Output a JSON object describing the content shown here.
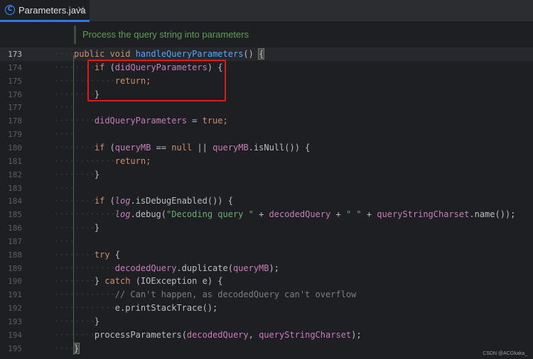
{
  "tab": {
    "icon": "class-c-icon",
    "label": "Parameters.java",
    "close": "×"
  },
  "doc_comment": "Process the query string into parameters",
  "lines": [
    {
      "num": "173",
      "tokens": [
        [
          "kw",
          "public "
        ],
        [
          "kw",
          "void "
        ],
        [
          "fn",
          "handleQueryParameters"
        ],
        [
          "p",
          "() "
        ],
        [
          "brace",
          "{"
        ]
      ]
    },
    {
      "num": "174",
      "tokens": [
        [
          "kw",
          "if "
        ],
        [
          "p",
          "("
        ],
        [
          "fld",
          "didQueryParameters"
        ],
        [
          "p",
          ") {"
        ]
      ]
    },
    {
      "num": "175",
      "tokens": [
        [
          "kw",
          "return"
        ],
        [
          "kw",
          ";"
        ]
      ]
    },
    {
      "num": "176",
      "tokens": [
        [
          "p",
          "}"
        ]
      ]
    },
    {
      "num": "177",
      "tokens": []
    },
    {
      "num": "178",
      "tokens": [
        [
          "fld",
          "didQueryParameters"
        ],
        [
          "p",
          " = "
        ],
        [
          "kw",
          "true"
        ],
        [
          "kw",
          ";"
        ]
      ]
    },
    {
      "num": "179",
      "tokens": []
    },
    {
      "num": "180",
      "tokens": [
        [
          "kw",
          "if "
        ],
        [
          "p",
          "("
        ],
        [
          "fld",
          "queryMB"
        ],
        [
          "p",
          " == "
        ],
        [
          "kw",
          "null"
        ],
        [
          "p",
          " || "
        ],
        [
          "fld",
          "queryMB"
        ],
        [
          "p",
          ".isNull()) {"
        ]
      ]
    },
    {
      "num": "181",
      "tokens": [
        [
          "kw",
          "return"
        ],
        [
          "kw",
          ";"
        ]
      ]
    },
    {
      "num": "182",
      "tokens": [
        [
          "p",
          "}"
        ]
      ]
    },
    {
      "num": "183",
      "tokens": []
    },
    {
      "num": "184",
      "tokens": [
        [
          "kw",
          "if "
        ],
        [
          "p",
          "("
        ],
        [
          "fldit",
          "log"
        ],
        [
          "p",
          ".isDebugEnabled()) {"
        ]
      ]
    },
    {
      "num": "185",
      "tokens": [
        [
          "fldit",
          "log"
        ],
        [
          "p",
          ".debug("
        ],
        [
          "str",
          "\"Decoding query \""
        ],
        [
          "p",
          " + "
        ],
        [
          "fld",
          "decodedQuery"
        ],
        [
          "p",
          " + "
        ],
        [
          "str",
          "\" \""
        ],
        [
          "p",
          " + "
        ],
        [
          "fld",
          "queryStringCharset"
        ],
        [
          "p",
          ".name());"
        ]
      ]
    },
    {
      "num": "186",
      "tokens": [
        [
          "p",
          "}"
        ]
      ]
    },
    {
      "num": "187",
      "tokens": []
    },
    {
      "num": "188",
      "tokens": [
        [
          "kw",
          "try "
        ],
        [
          "p",
          "{"
        ]
      ]
    },
    {
      "num": "189",
      "tokens": [
        [
          "fld",
          "decodedQuery"
        ],
        [
          "p",
          ".duplicate("
        ],
        [
          "fld",
          "queryMB"
        ],
        [
          "p",
          ");"
        ]
      ]
    },
    {
      "num": "190",
      "tokens": [
        [
          "p",
          "} "
        ],
        [
          "kw",
          "catch "
        ],
        [
          "p",
          "(IOException e) {"
        ]
      ]
    },
    {
      "num": "191",
      "tokens": [
        [
          "cm",
          "// Can't happen, as decodedQuery can't overflow"
        ]
      ]
    },
    {
      "num": "192",
      "tokens": [
        [
          "p",
          "e.printStackTrace();"
        ]
      ]
    },
    {
      "num": "193",
      "tokens": [
        [
          "p",
          "}"
        ]
      ]
    },
    {
      "num": "194",
      "tokens": [
        [
          "p",
          "processParameters("
        ],
        [
          "fld",
          "decodedQuery"
        ],
        [
          "p",
          ", "
        ],
        [
          "fld",
          "queryStringCharset"
        ],
        [
          "p",
          ");"
        ]
      ]
    },
    {
      "num": "195",
      "tokens": [
        [
          "brace",
          "}"
        ]
      ]
    }
  ],
  "indents": [
    0,
    1,
    2,
    1,
    0,
    1,
    0,
    1,
    2,
    1,
    0,
    1,
    2,
    1,
    0,
    1,
    2,
    1,
    2,
    2,
    1,
    1,
    0
  ],
  "current_line": "173",
  "watermark": "CSDN @ACGkaka_"
}
